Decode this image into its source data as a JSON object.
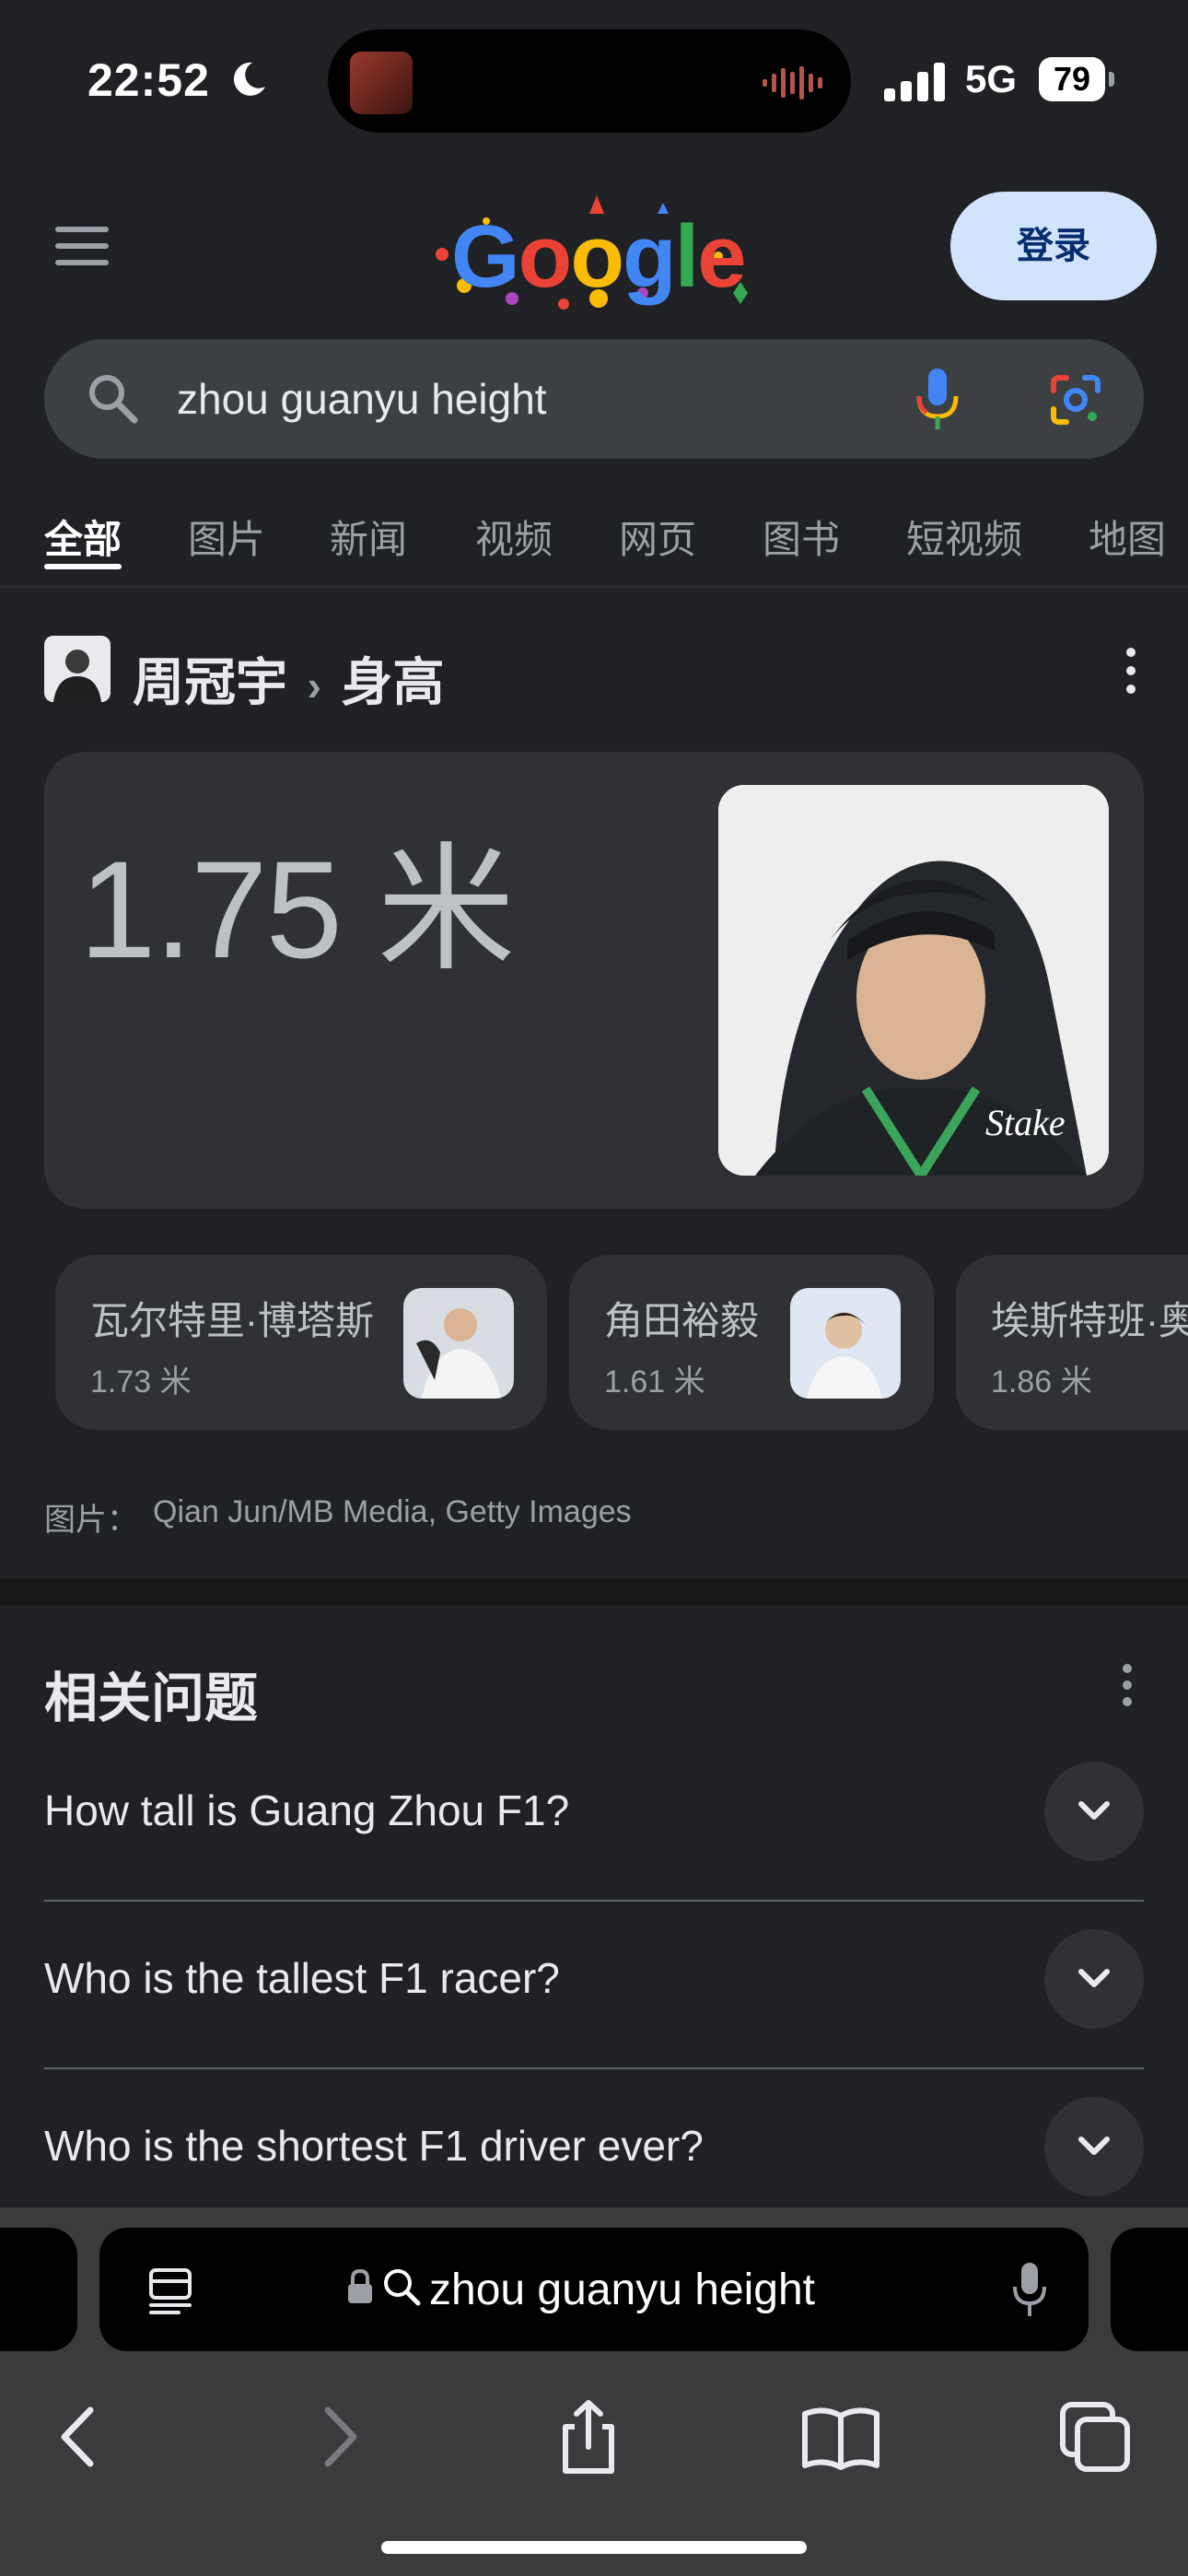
{
  "status_bar": {
    "time": "22:52",
    "network": "5G",
    "battery": "79"
  },
  "header": {
    "logo_text": "Google",
    "signin_label": "登录"
  },
  "search": {
    "query": "zhou guanyu height"
  },
  "tabs": [
    {
      "label": "全部",
      "active": true
    },
    {
      "label": "图片"
    },
    {
      "label": "新闻"
    },
    {
      "label": "视频"
    },
    {
      "label": "网页"
    },
    {
      "label": "图书"
    },
    {
      "label": "短视频"
    },
    {
      "label": "地图"
    }
  ],
  "knowledge_panel": {
    "entity": "周冠宇",
    "separator": "›",
    "attribute": "身高",
    "answer": "1.75 米",
    "related_people": [
      {
        "name": "瓦尔特里·博塔斯",
        "value": "1.73 米"
      },
      {
        "name": "角田裕毅",
        "value": "1.61 米"
      },
      {
        "name": "埃斯特班·奥",
        "value": "1.86 米"
      }
    ],
    "image_credit_label": "图片：",
    "image_credit": "Qian Jun/MB Media, Getty Images"
  },
  "related_questions": {
    "title": "相关问题",
    "items": [
      "How tall is Guang Zhou F1?",
      "Who is the tallest F1 racer?",
      "Who is the shortest F1 driver ever?"
    ]
  },
  "browser_bar": {
    "url": "zhou guanyu height"
  },
  "colors": {
    "background": "#202124",
    "card": "#303134",
    "signin_bg": "#d2e3fc",
    "google_blue": "#4285f4",
    "google_red": "#ea4335",
    "google_yellow": "#fbbc05",
    "google_green": "#34a853"
  }
}
